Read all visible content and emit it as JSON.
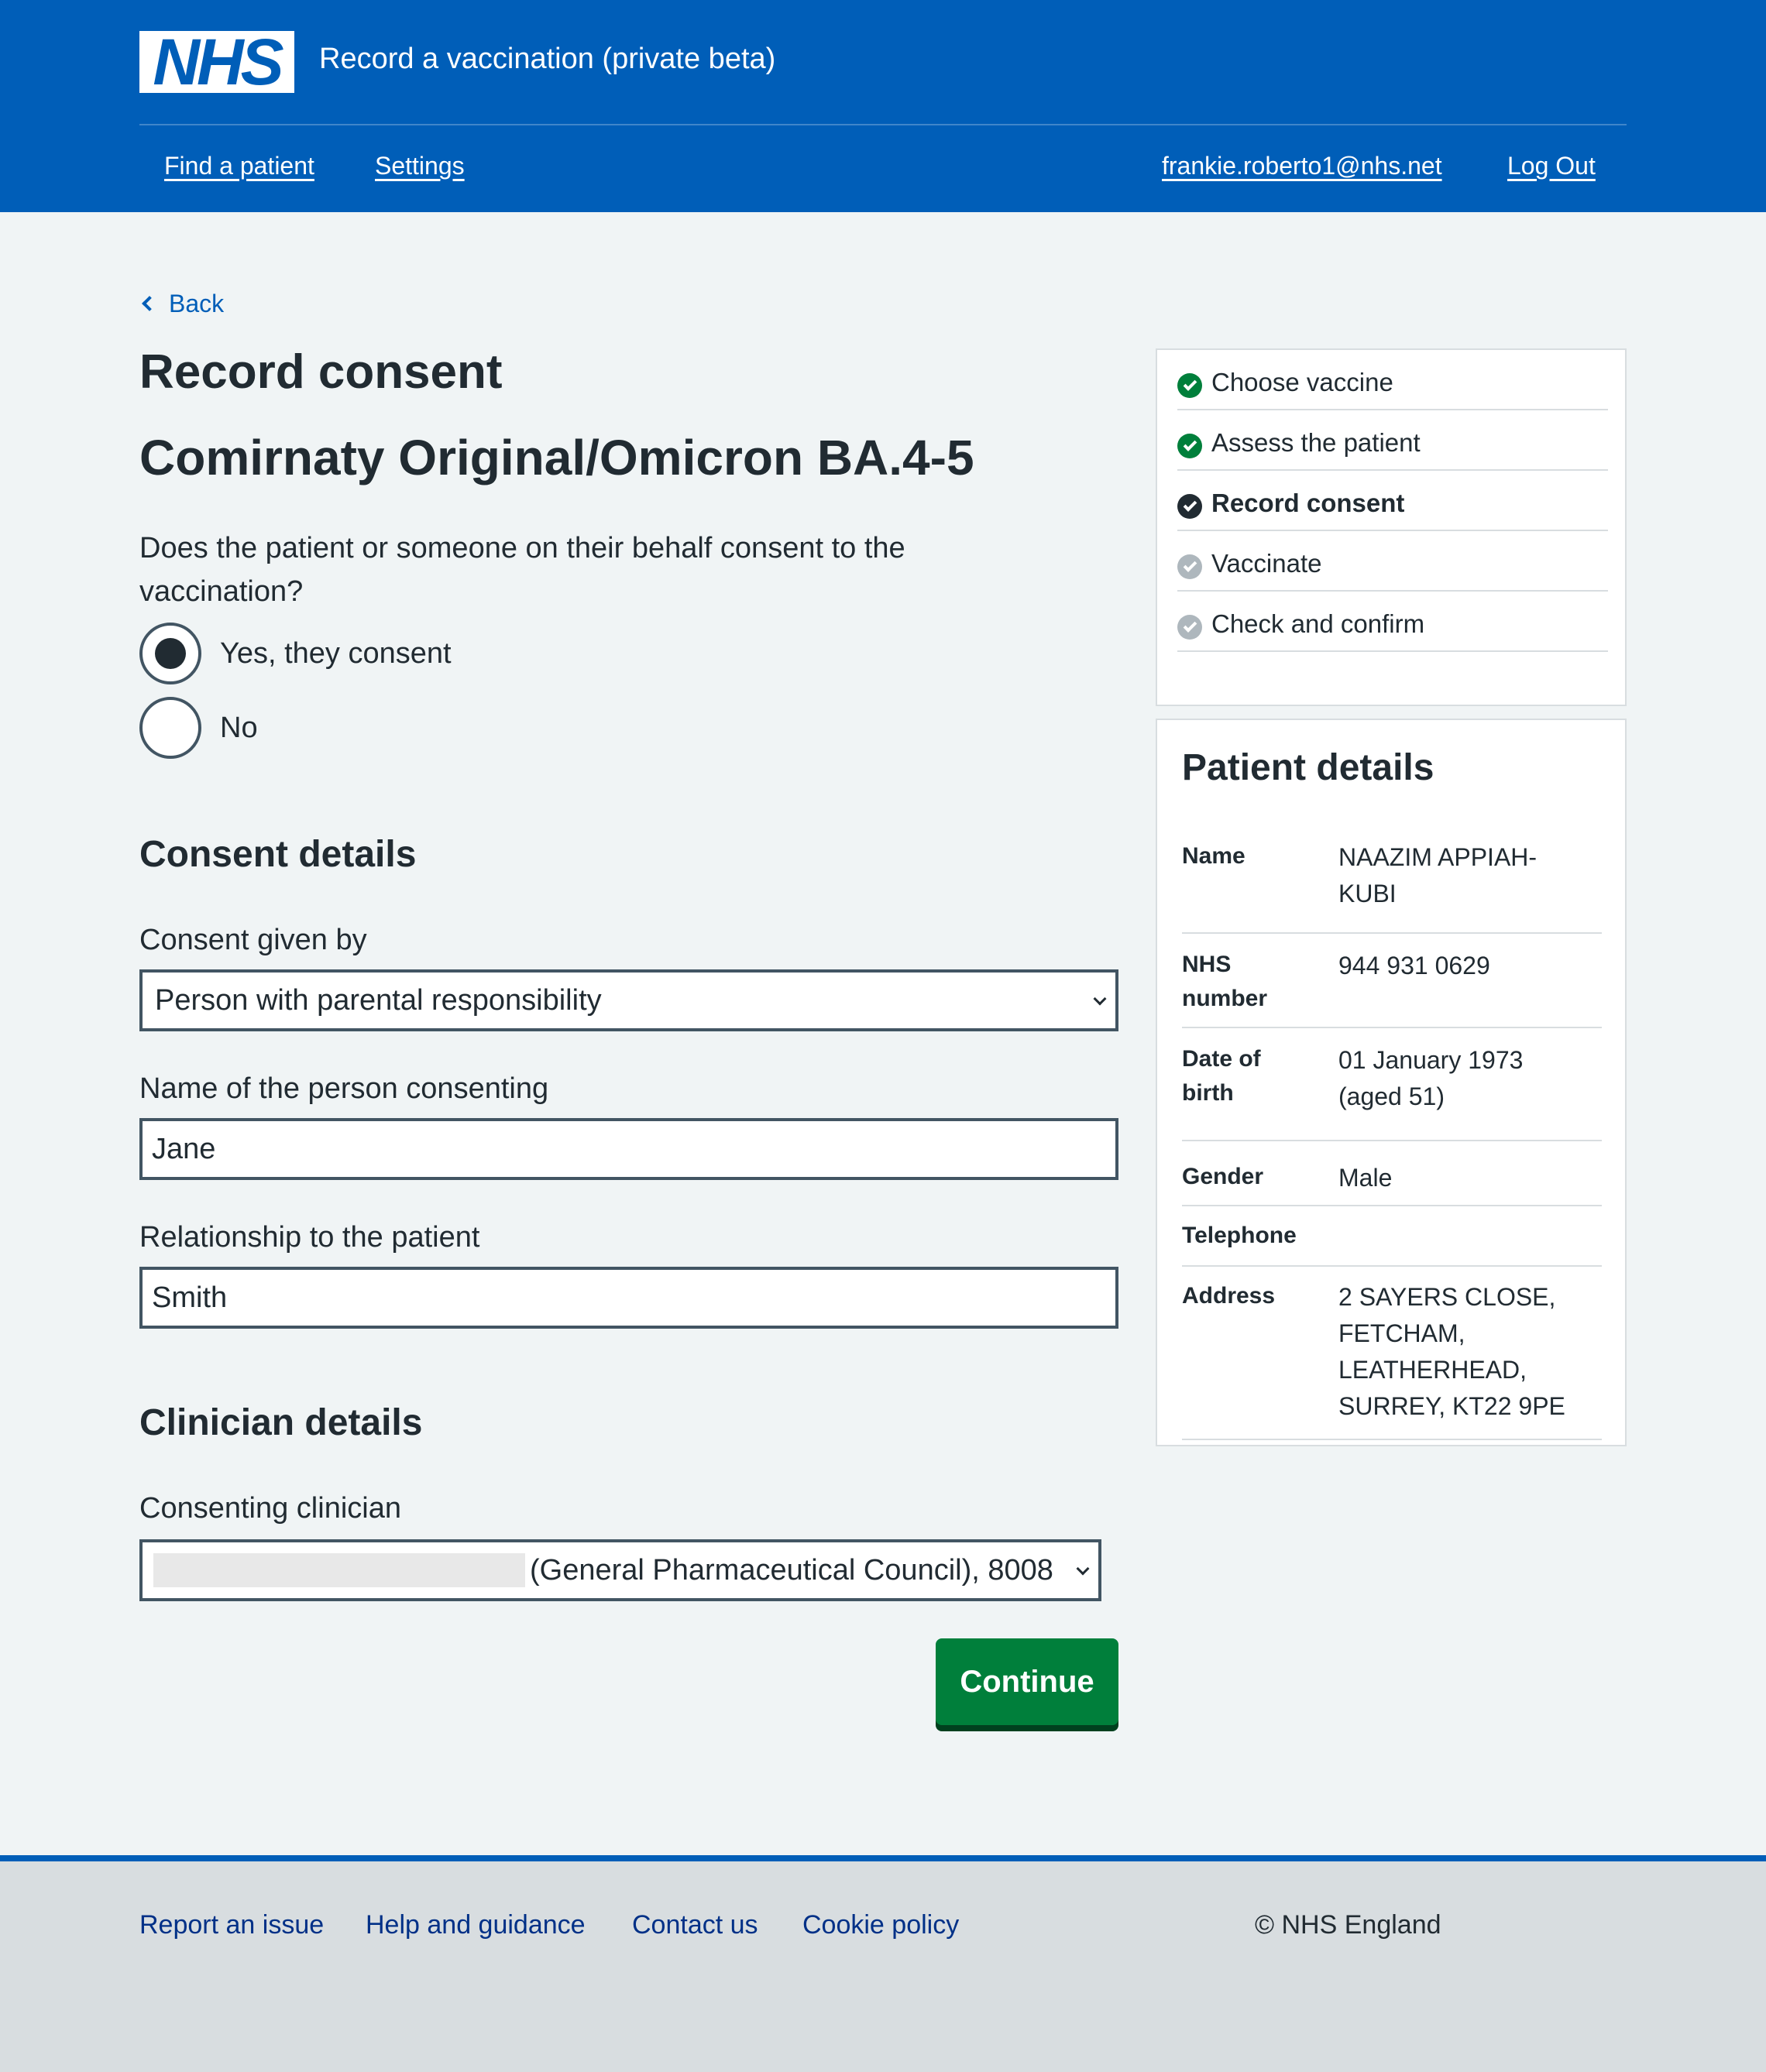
{
  "header": {
    "logo_text": "NHS",
    "service_name": "Record a vaccination (private beta)",
    "nav": {
      "find_patient": "Find a patient",
      "settings": "Settings",
      "user_email": "frankie.roberto1@nhs.net",
      "log_out": "Log Out"
    }
  },
  "main": {
    "back_label": "Back",
    "title": "Record consent",
    "vaccine": "Comirnaty Original/Omicron BA.4-5",
    "question": "Does the patient or someone on their behalf consent to the vaccination?",
    "radio_options": [
      {
        "label": "Yes, they consent",
        "selected": true
      },
      {
        "label": "No",
        "selected": false
      }
    ],
    "consent_details": {
      "heading": "Consent details",
      "given_by_label": "Consent given by",
      "given_by_value": "Person with parental responsibility",
      "name_label": "Name of the person consenting",
      "name_value": "Jane",
      "relationship_label": "Relationship to the patient",
      "relationship_value": "Smith"
    },
    "clinician_details": {
      "heading": "Clinician details",
      "clinician_label": "Consenting clinician",
      "clinician_value": "(General Pharmaceutical Council), 8008"
    },
    "continue_label": "Continue"
  },
  "steps": [
    {
      "label": "Choose vaccine",
      "status": "complete"
    },
    {
      "label": "Assess the patient",
      "status": "complete"
    },
    {
      "label": "Record consent",
      "status": "current"
    },
    {
      "label": "Vaccinate",
      "status": "pending"
    },
    {
      "label": "Check and confirm",
      "status": "pending"
    }
  ],
  "patient": {
    "heading": "Patient details",
    "rows": [
      {
        "key": "Name",
        "value": "NAAZIM APPIAH-\nKUBI"
      },
      {
        "key": "NHS number",
        "value": "944 931 0629"
      },
      {
        "key": "Date of birth",
        "value": "01 January 1973\n(aged 51)"
      },
      {
        "key": "Gender",
        "value": "Male"
      },
      {
        "key": "Telephone",
        "value": ""
      },
      {
        "key": "Address",
        "value": "2 SAYERS CLOSE,\nFETCHAM,\nLEATHERHEAD,\nSURREY, KT22 9PE"
      }
    ]
  },
  "footer": {
    "links": [
      "Report an issue",
      "Help and guidance",
      "Contact us",
      "Cookie policy"
    ],
    "copyright": "© NHS England"
  },
  "colors": {
    "nhs_blue": "#005eb8",
    "success_green": "#007f3b",
    "pending_grey": "#aeb7bd",
    "text": "#212b32"
  }
}
